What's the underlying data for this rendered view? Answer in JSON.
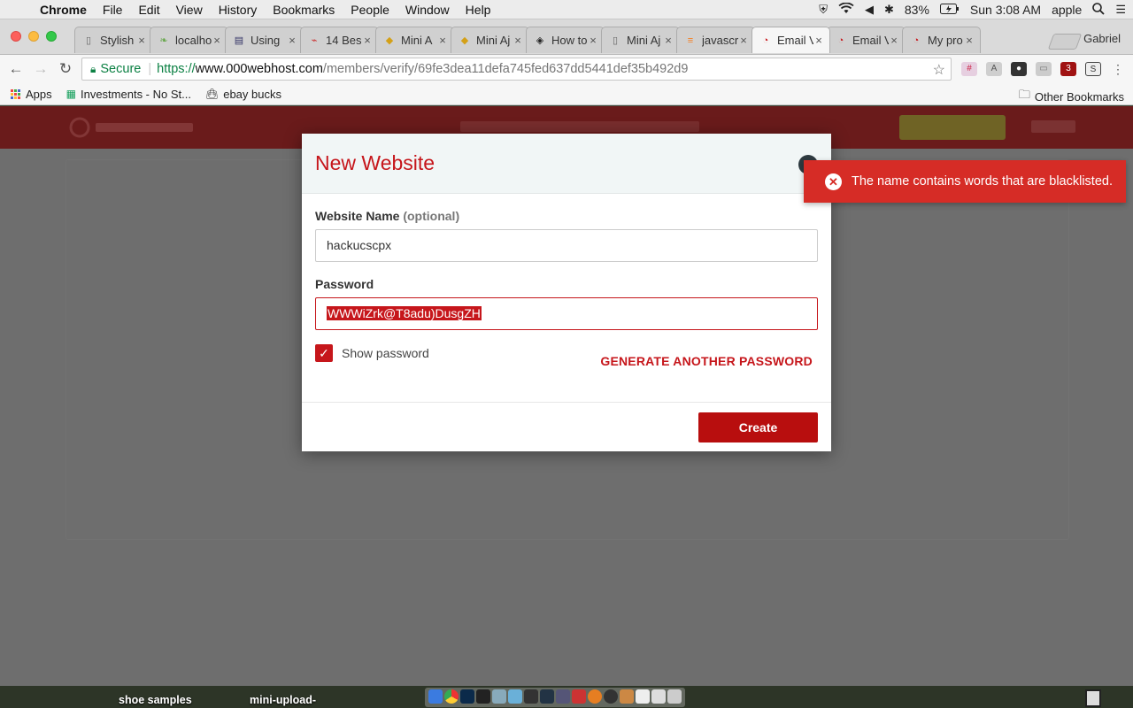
{
  "menubar": {
    "app": "Chrome",
    "items": [
      "File",
      "Edit",
      "View",
      "History",
      "Bookmarks",
      "People",
      "Window",
      "Help"
    ],
    "battery": "83%",
    "clock": "Sun 3:08 AM",
    "user": "apple"
  },
  "tabs": [
    {
      "label": "Stylish",
      "favicon": "page-icon"
    },
    {
      "label": "localho",
      "favicon": "leaf-icon"
    },
    {
      "label": "Using",
      "favicon": "doc-icon"
    },
    {
      "label": "14 Bes",
      "favicon": "brand-icon"
    },
    {
      "label": "Mini A",
      "favicon": "python-icon"
    },
    {
      "label": "Mini Aj",
      "favicon": "python-icon"
    },
    {
      "label": "How to",
      "favicon": "diamond-icon"
    },
    {
      "label": "Mini Aj",
      "favicon": "page-icon"
    },
    {
      "label": "javascr",
      "favicon": "stackoverflow-icon"
    },
    {
      "label": "Email V",
      "favicon": "webhost-icon",
      "active": true
    },
    {
      "label": "Email V",
      "favicon": "webhost-icon"
    },
    {
      "label": "My pro",
      "favicon": "webhost-icon"
    }
  ],
  "profile": "Gabriel",
  "omnibox": {
    "secure_label": "Secure",
    "url_scheme": "https://",
    "url_host": "www.000webhost.com",
    "url_path": "/members/verify/69fe3dea11defa745fed637dd5441def35b492d9"
  },
  "bookmarks": {
    "apps": "Apps",
    "items": [
      "Investments - No St...",
      "ebay bucks"
    ],
    "other": "Other Bookmarks"
  },
  "modal": {
    "title": "New Website",
    "website_name_label": "Website Name",
    "website_name_optional": "(optional)",
    "website_name_value": "hackucscpx",
    "password_label": "Password",
    "password_value": "WWWiZrk@T8adu)DusgZH",
    "show_password_label": "Show password",
    "show_password_checked": true,
    "generate_label": "GENERATE ANOTHER PASSWORD",
    "create_label": "Create"
  },
  "toast": {
    "message": "The name contains words that are blacklisted."
  },
  "desktop": {
    "items": [
      "shoe samples",
      "mini-upload-"
    ]
  },
  "colors": {
    "brand_red": "#c6161b",
    "toast_red": "#d62c26",
    "secure_green": "#0b8043"
  }
}
